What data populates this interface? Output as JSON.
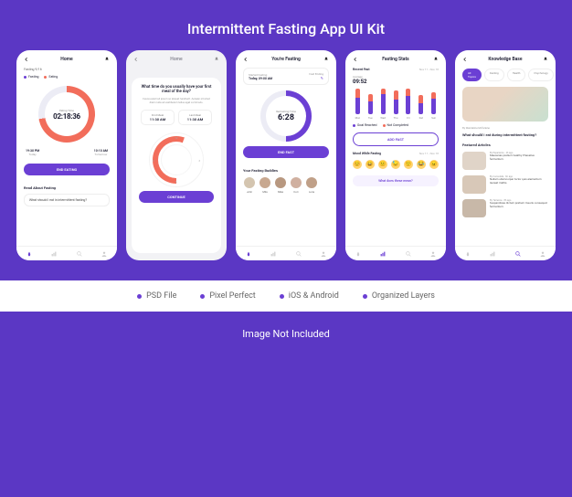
{
  "header": {
    "title": "Intermittent Fasting App UI Kit"
  },
  "features": [
    "PSD File",
    "Pixel Perfect",
    "iOS & Android",
    "Organized Layers"
  ],
  "not_included": "Image Not Included",
  "colors": {
    "accent": "#6b3fd4",
    "secondary": "#f26d5b"
  },
  "screens": {
    "s1": {
      "title": "Home",
      "fasting_label": "Fasting 9/16",
      "legend": {
        "fasting": "Fasting",
        "eating": "Eating"
      },
      "ring": {
        "label": "Eating Time",
        "value": "02:18:36"
      },
      "times": {
        "left_time": "19:30 PM",
        "left_label": "Today",
        "right_time": "10:10 AM",
        "right_label": "Tomorrow"
      },
      "cta": "END EATING",
      "section": "Read About Fasting",
      "article": "What should I eat in intermittent fasting?"
    },
    "s2": {
      "title": "Home",
      "question": "What time do you usually have your first meal of the day?",
      "subtitle": "Fusce euismod ipsum ac aliquet hendrerit. Aenean sit amet diam nulla ad vestibulum tellus eget commodo.",
      "first_meal": {
        "label": "First Meal",
        "time": "11:30 AM"
      },
      "last_meal": {
        "label": "Last Meal",
        "time": "11:30 AM"
      },
      "cta": "CONTINUE"
    },
    "s3": {
      "title": "You're Fasting",
      "started": {
        "label": "Started Fasting",
        "value": "Today, 09:00 AM",
        "ending": "Fast Ending"
      },
      "ring": {
        "label": "Remaining Time",
        "value": "6:28"
      },
      "cta": "END FAST",
      "buddies_title": "Your Fasting Buddies",
      "buddies": [
        {
          "name": "John"
        },
        {
          "name": "Mila"
        },
        {
          "name": "Mike"
        },
        {
          "name": "Kori"
        },
        {
          "name": "Luna"
        }
      ]
    },
    "s4": {
      "title": "Fasting Stats",
      "recent": {
        "label": "Recent Fast",
        "range": "Nov 11 - Nov 18"
      },
      "average": {
        "label": "Average",
        "value": "09:52"
      },
      "days": [
        "Mon",
        "Tue",
        "Wed",
        "Thu",
        "Fri",
        "Sat",
        "Sun"
      ],
      "bars": [
        {
          "p": 18,
          "o": 10
        },
        {
          "p": 14,
          "o": 8
        },
        {
          "p": 22,
          "o": 6
        },
        {
          "p": 16,
          "o": 10
        },
        {
          "p": 20,
          "o": 8
        },
        {
          "p": 12,
          "o": 9
        },
        {
          "p": 17,
          "o": 7
        }
      ],
      "legend": {
        "goal": "Goal Reached",
        "not": "Not Completed"
      },
      "add_fast": "ADD FAST",
      "mood": {
        "label": "Mood While Fasting",
        "range": "Nov 11 - Nov 18"
      },
      "insight": "What does these mean?"
    },
    "s5": {
      "title": "Knowledge Base",
      "chips": [
        "All Topics",
        "Fasting",
        "Health",
        "Psychology"
      ],
      "hero": {
        "meta": "By Wendeline Mcfarlene",
        "title": "What should I eat during intermittent fasting?"
      },
      "featured_label": "Featured Articles",
      "articles": [
        {
          "meta": "By Esperanza  ·  4h ago",
          "text": "Maecenas pretium healthy Phasellus fermentum."
        },
        {
          "meta": "By Consolata  ·  6h ago",
          "text": "Nullam ullamcorper tortor quis elementum laoreet mattis."
        },
        {
          "meta": "By Terrence  ·  8h ago",
          "text": "Suspendisse dictum pretium mauris consequat fermentum."
        }
      ]
    }
  }
}
